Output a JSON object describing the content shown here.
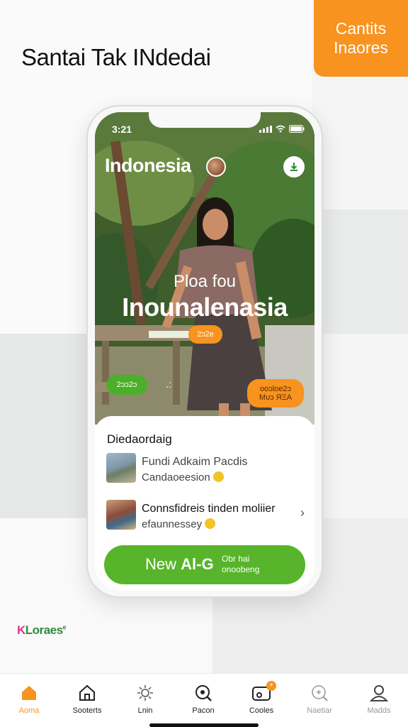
{
  "headline": "Santai Tak INdedai",
  "corner_badge": {
    "line1": "Cantits",
    "line2": "Inaores",
    "color": "#f7931e"
  },
  "phone": {
    "status_time": "3:21",
    "country_title": "Indonesia",
    "overlay_subtitle": "Ploa fou",
    "overlay_title": "Inounalenasia",
    "pill_small": "2ɔ2e",
    "pill_green": "2ɔɔ2ɔ",
    "pill_dots": ".:",
    "pill_orange_line1": "ooɔloe2ɔ",
    "pill_orange_line2": "Mυɔ ЯΞΑ",
    "card": {
      "title": "Diedaordaig",
      "items": [
        {
          "line1": "Fundi Adkaim Pacdis",
          "line2": "Candaoeesion"
        },
        {
          "line1": "Connsfidreis tinden moliier",
          "line2": "efaunnessey"
        }
      ]
    },
    "cta": {
      "main_light": "New ",
      "main_bold": "Al-G",
      "sub_line1": "Obr hai",
      "sub_line2": "onoobeng"
    }
  },
  "brand": {
    "prefix": "K",
    "name": "Loraes",
    "suffix": "e"
  },
  "tabs": [
    {
      "label": "Aoma",
      "icon": "home-icon"
    },
    {
      "label": "Sooterts",
      "icon": "house-outline-icon"
    },
    {
      "label": "Lnin",
      "icon": "sun-burst-icon"
    },
    {
      "label": "Pacon",
      "icon": "search-icon"
    },
    {
      "label": "Cooles",
      "icon": "camera-icon",
      "badge": "+"
    },
    {
      "label": "Naetiar",
      "icon": "search-plus-icon"
    },
    {
      "label": "Madds",
      "icon": "profile-icon"
    }
  ],
  "colors": {
    "accent": "#f7931e",
    "green": "#58b42a",
    "brand_green": "#2e8b3e",
    "brand_pink": "#e0348a"
  }
}
